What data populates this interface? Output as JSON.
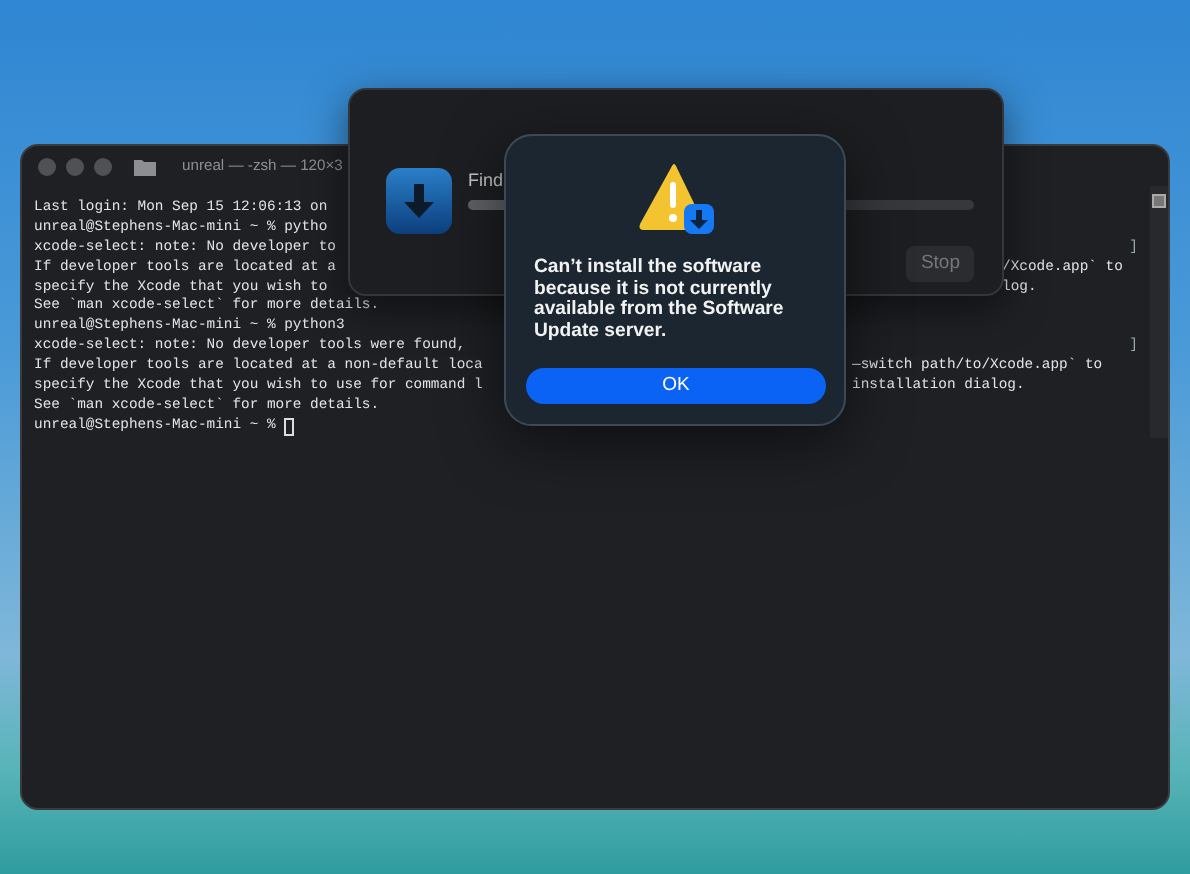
{
  "terminal": {
    "title": "unreal — -zsh — 120×3",
    "lines": [
      {
        "text": "Last login: Mon Sep 15 12:06:13 on"
      },
      {
        "text": "unreal@Stephens-Mac-mini ~ % pytho"
      },
      {
        "text": "xcode-select: note: No developer to",
        "end_mark": "]"
      },
      {
        "text": "If developer tools are located at a",
        "right": "/Xcode.app` to",
        "kind": "behind_installer"
      },
      {
        "text": "specify the Xcode that you wish to",
        "right": "log.",
        "kind": "behind_installer"
      },
      {
        "text": "See `man xcode-select` for more details."
      },
      {
        "text": "unreal@Stephens-Mac-mini ~ % python3"
      },
      {
        "text": "xcode-select: note: No developer tools were found, ",
        "end_mark": "]"
      },
      {
        "text": "If developer tools are located at a non-default loca",
        "right": "—switch path/to/Xcode.app` to",
        "kind": "behind_alert"
      },
      {
        "text": "specify the Xcode that you wish to use for command l",
        "right": "installation dialog.",
        "kind": "behind_alert"
      },
      {
        "text": "See `man xcode-select` for more details."
      },
      {
        "text": "unreal@Stephens-Mac-mini ~ % ",
        "cursor": true
      }
    ]
  },
  "installer": {
    "status": "Find",
    "level": 0.35,
    "stop_button": {
      "label": "Stop",
      "disabled": true
    }
  },
  "alert": {
    "message": "Can’t install the software because it is not currently available from the Software Update server.",
    "button": "OK"
  }
}
